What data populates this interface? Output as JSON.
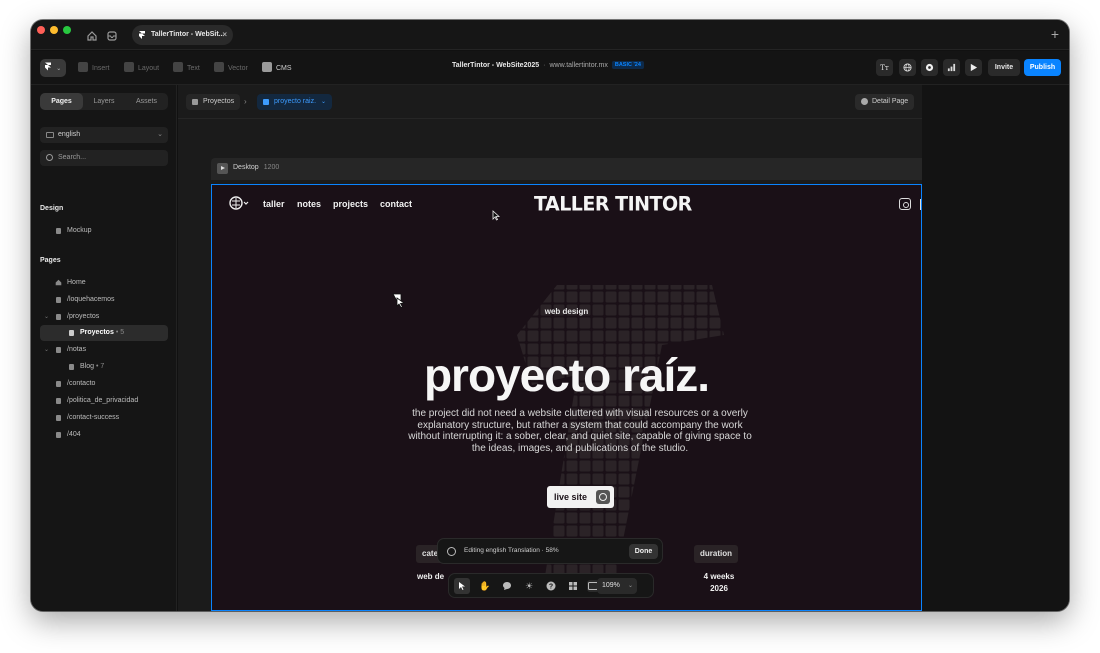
{
  "colors": {
    "accent": "#0a84ff",
    "site_bg": "#1a1017",
    "app_bg": "#111111"
  },
  "browser": {
    "tab_title": "TallerTintor - WebSit...",
    "tab_close": "×",
    "new_tab": "+"
  },
  "toolbar": {
    "menu_label": "F",
    "insert": "Insert",
    "layout": "Layout",
    "text": "Text",
    "vector": "Vector",
    "cms": "CMS",
    "doc_title": "TallerTintor - WebSite2025",
    "separator": "·",
    "site_url": "www.tallertintor.mx",
    "plan_badge": "BASIC '24",
    "invite": "Invite",
    "publish": "Publish"
  },
  "sidebar": {
    "tabs": [
      "Pages",
      "Layers",
      "Assets"
    ],
    "locale": "english",
    "search_placeholder": "Search...",
    "design_heading": "Design",
    "design_items": [
      "Mockup"
    ],
    "pages_heading": "Pages",
    "pages": [
      {
        "label": "Home",
        "count": ""
      },
      {
        "label": "/loquehacemos",
        "count": ""
      },
      {
        "label": "/proyectos",
        "count": ""
      },
      {
        "label": "Proyectos",
        "count": "• 5"
      },
      {
        "label": "/notas",
        "count": ""
      },
      {
        "label": "Blog",
        "count": "• 7"
      },
      {
        "label": "/contacto",
        "count": ""
      },
      {
        "label": "/politica_de_privacidad",
        "count": ""
      },
      {
        "label": "/contact-success",
        "count": ""
      },
      {
        "label": "/404",
        "count": ""
      }
    ]
  },
  "canvas": {
    "breadcrumb_root": "Proyectos",
    "breadcrumb_sep": "›",
    "breadcrumb_current": "proyecto raiz.",
    "detail_page": "Detail Page",
    "frame_name": "Desktop",
    "frame_width": "1200"
  },
  "site": {
    "nav": [
      "taller",
      "notes",
      "projects",
      "contact"
    ],
    "brand": "TALLER TINTOR",
    "eyebrow": "web design",
    "title": "proyecto raíz.",
    "description": "the project did not need a website cluttered with visual resources or a overly explanatory structure, but rather a system that could accompany the work without interrupting it: a sober, clear, and quiet site, capable of giving space to the ideas, images, and publications of the studio.",
    "live_site": "live site",
    "meta_left_label": "cate",
    "meta_left_value": "web de",
    "meta_right_label": "duration",
    "meta_right_value_1": "4 weeks",
    "meta_right_value_2": "2026"
  },
  "translation_bar": {
    "text": "Editing english Translation · 58%",
    "done": "Done"
  },
  "bottom_toolbar": {
    "zoom": "109%"
  }
}
